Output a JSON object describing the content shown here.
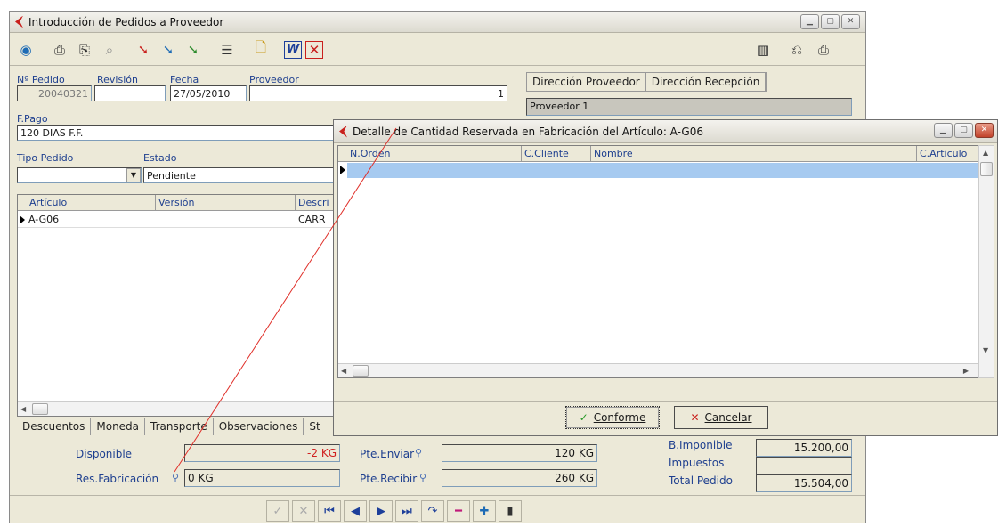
{
  "main_window": {
    "title": "Introducción de Pedidos a Proveedor",
    "fields": {
      "num_pedido": {
        "label": "Nº Pedido",
        "value": "20040321"
      },
      "revision": {
        "label": "Revisión",
        "value": ""
      },
      "fecha": {
        "label": "Fecha",
        "value": "27/05/2010"
      },
      "proveedor": {
        "label": "Proveedor",
        "value": "1"
      },
      "forma_pago": {
        "label": "F.Pago",
        "value": "120 DIAS F.F."
      },
      "tipo_pedido": {
        "label": "Tipo Pedido",
        "value": ""
      },
      "estado": {
        "label": "Estado",
        "value": "Pendiente"
      }
    },
    "address_tabs": [
      "Dirección Proveedor",
      "Dirección Recepción"
    ],
    "address_value": "Proveedor 1",
    "lines_grid": {
      "columns": [
        "Artículo",
        "Versión",
        "Descri"
      ],
      "rows": [
        [
          "A-G06",
          "",
          "CARR"
        ]
      ]
    },
    "bottom_tabs": [
      "Descuentos",
      "Moneda",
      "Transporte",
      "Observaciones",
      "St"
    ],
    "stock": {
      "disponible": {
        "label": "Disponible",
        "value": "-2 KG"
      },
      "res_fabricacion": {
        "label": "Res.Fabricación",
        "value": "0 KG"
      },
      "pte_enviar": {
        "label": "Pte.Enviar",
        "value": "120 KG"
      },
      "pte_recibir": {
        "label": "Pte.Recibir",
        "value": "260 KG"
      }
    },
    "totals": {
      "base_imponible": {
        "label": "B.Imponible",
        "value": "15.200,00"
      },
      "impuestos": {
        "label": "Impuestos",
        "value": ""
      },
      "total_pedido": {
        "label": "Total Pedido",
        "value": "15.504,00"
      }
    },
    "nav_buttons": [
      "check-icon",
      "cancel-x-icon",
      "first-icon",
      "prev-icon",
      "next-icon",
      "last-icon",
      "refresh-icon",
      "delete-icon",
      "add-icon",
      "post-icon"
    ]
  },
  "dialog": {
    "title": "Detalle de Cantidad Reservada en Fabricación del Artículo: A-G06",
    "columns": [
      "N.Orden",
      "C.Cliente",
      "Nombre",
      "C.Articulo"
    ],
    "buttons": {
      "ok": "Conforme",
      "cancel": "Cancelar"
    }
  },
  "colors": {
    "brand_red": "#c9201d",
    "label_blue": "#1e3f8f",
    "selected_row": "#a6caf0",
    "annotation_line": "#e0302a"
  }
}
